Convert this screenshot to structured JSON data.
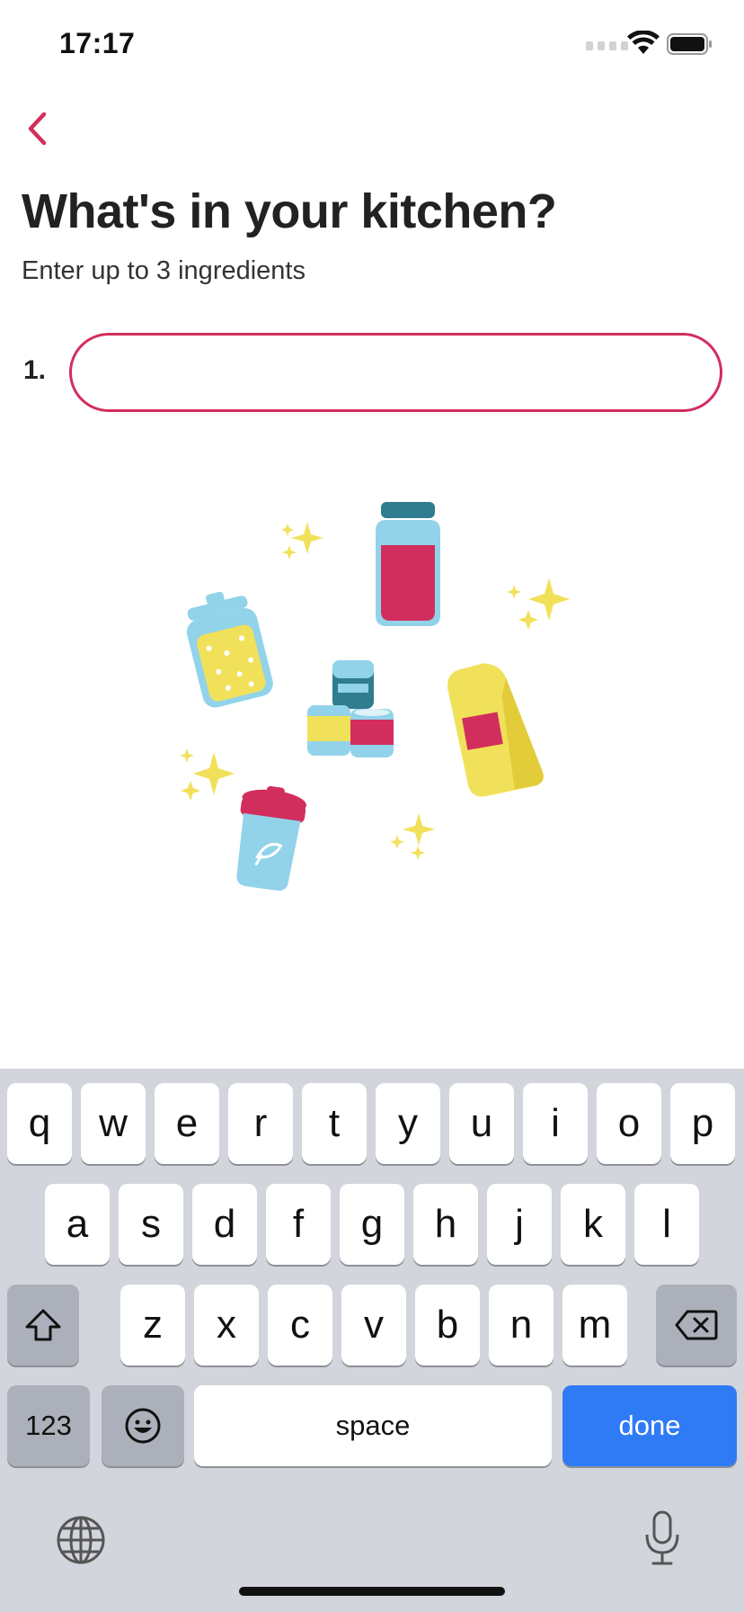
{
  "status_bar": {
    "time": "17:17"
  },
  "header": {
    "title": "What's in your kitchen?",
    "subtitle": "Enter up to 3 ingredients"
  },
  "ingredients": [
    {
      "number": "1.",
      "value": "",
      "placeholder": ""
    }
  ],
  "colors": {
    "accent": "#d22e5d",
    "keyboard_bg": "#d3d5dc",
    "done_key": "#2f7bf6",
    "illustration_yellow": "#f1e15a",
    "illustration_blue": "#92d3ea",
    "illustration_teal": "#2f7d8f"
  },
  "keyboard": {
    "row1": [
      "q",
      "w",
      "e",
      "r",
      "t",
      "y",
      "u",
      "i",
      "o",
      "p"
    ],
    "row2": [
      "a",
      "s",
      "d",
      "f",
      "g",
      "h",
      "j",
      "k",
      "l"
    ],
    "row3": [
      "z",
      "x",
      "c",
      "v",
      "b",
      "n",
      "m"
    ],
    "numbers_label": "123",
    "space_label": "space",
    "done_label": "done",
    "icons": [
      "shift-icon",
      "backspace-icon",
      "emoji-icon",
      "globe-icon",
      "microphone-icon"
    ]
  }
}
